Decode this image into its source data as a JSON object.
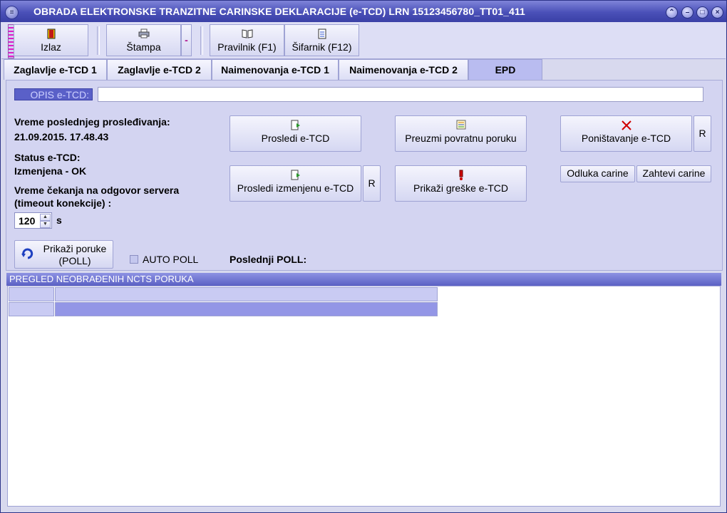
{
  "window": {
    "title": "OBRADA ELEKTRONSKE TRANZITNE CARINSKE DEKLARACIJE (e-TCD)  LRN 15123456780_TT01_411"
  },
  "toolbar": {
    "izlaz_label": "Izlaz",
    "stampa_label": "Štampa",
    "stampa_menu": "-",
    "pravilnik_label": "Pravilnik (F1)",
    "sifarnik_label": "Šifarnik (F12)"
  },
  "tabs": [
    {
      "label": "Zaglavlje e-TCD 1"
    },
    {
      "label": "Zaglavlje e-TCD 2"
    },
    {
      "label": "Naimenovanja e-TCD 1"
    },
    {
      "label": "Naimenovanja e-TCD 2"
    },
    {
      "label": "EPD"
    }
  ],
  "form": {
    "opis_label": "OPIS e-TCD:",
    "opis_value": "",
    "last_forward_label": "Vreme poslednjeg prosleđivanja:",
    "last_forward_value": "21.09.2015. 17.48.43",
    "status_label": "Status e-TCD:",
    "status_value": "Izmenjena - OK",
    "timeout_label_1": "Vreme čekanja na odgovor servera",
    "timeout_label_2": "(timeout konekcije) :",
    "timeout_value": "120",
    "timeout_unit": "s",
    "auto_poll_label": "AUTO POLL",
    "last_poll_label": "Poslednji POLL:"
  },
  "actions": {
    "prosledi": "Prosledi e-TCD",
    "preuzmi": "Preuzmi povratnu poruku",
    "ponistavanje": "Poništavanje e-TCD",
    "r1": "R",
    "prosledi_izmenjenu": "Prosledi izmenjenu e-TCD",
    "r2": "R",
    "prikazi_greske": "Prikaži greške e-TCD",
    "odluka": "Odluka carine",
    "zahtevi": "Zahtevi carine",
    "poll_line1": "Prikaži poruke",
    "poll_line2": "(POLL)"
  },
  "grid": {
    "title": "PREGLED NEOBRAĐENIH NCTS PORUKA"
  },
  "icons": {
    "exit": "exit-door-icon",
    "print": "printer-icon",
    "book": "book-icon",
    "codebook": "document-list-icon",
    "forward": "document-arrow-icon",
    "receive": "message-list-icon",
    "cancel": "red-x-icon",
    "errors": "exclamation-icon",
    "refresh": "refresh-arrow-icon"
  }
}
